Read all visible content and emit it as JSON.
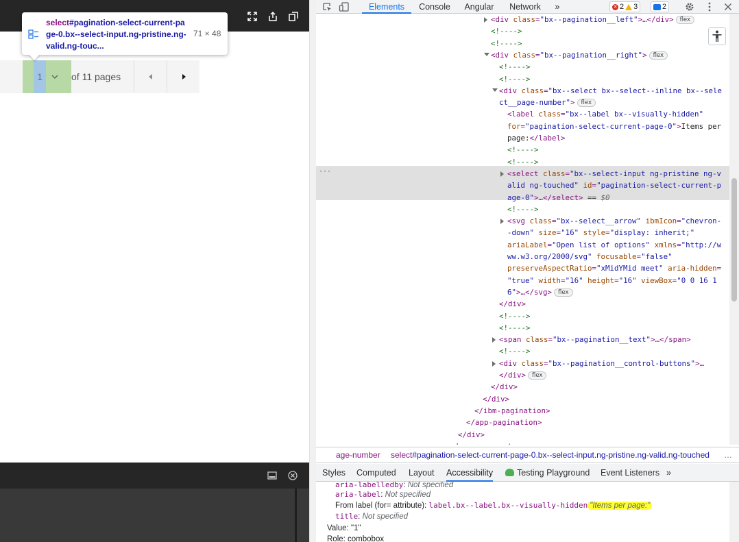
{
  "page": {
    "pager": {
      "current_page": "1",
      "of_pages_text": "of 11 pages"
    },
    "tooltip": {
      "tag": "select",
      "selector": "#pagination-select-current-page-0.bx--select-input.ng-pristine.ng-valid.ng-touc...",
      "size": "71 × 48"
    }
  },
  "devtools": {
    "tabs": [
      "Elements",
      "Console",
      "Angular",
      "Network"
    ],
    "tabs_more": "»",
    "errors_count": "2",
    "warnings_count": "3",
    "messages_count": "2",
    "dom_lines": [
      {
        "indent": 0,
        "arrow": "right",
        "html": "<span class=\"tg\">&lt;div </span><span class=\"attr\">class</span>=<span class=\"val\">\"bx--pagination__left\"</span>&gt;…&lt;/div&gt;",
        "badge": "flex"
      },
      {
        "indent": 0,
        "arrow": "",
        "html": "<span class=\"cmt\">&lt;!----&gt;</span>"
      },
      {
        "indent": 0,
        "arrow": "",
        "html": "<span class=\"cmt\">&lt;!----&gt;</span>"
      },
      {
        "indent": 0,
        "arrow": "down",
        "html": "&lt;div <span class=\"attr\">class</span>=<span class=\"val\">\"bx--pagination__right\"</span>&gt;",
        "badge": "flex"
      },
      {
        "indent": 1,
        "arrow": "",
        "html": "<span class=\"cmt\">&lt;!----&gt;</span>"
      },
      {
        "indent": 1,
        "arrow": "",
        "html": "<span class=\"cmt\">&lt;!----&gt;</span>"
      },
      {
        "indent": 1,
        "arrow": "down",
        "html": "&lt;div <span class=\"attr\">class</span>=<span class=\"val\">\"bx--select bx--select--inline bx--sele</span>"
      },
      {
        "indent": 1,
        "arrow": "",
        "html": "<span class=\"val\">ct__page-number\"</span>&gt;",
        "badge": "flex"
      },
      {
        "indent": 2,
        "arrow": "",
        "html": "&lt;label <span class=\"attr\">class</span>=<span class=\"val\">\"bx--label bx--visually-hidden\"</span>"
      },
      {
        "indent": 2,
        "arrow": "",
        "html": "<span class=\"attr\">for</span>=<span class=\"val\">\"pagination-select-current-page-0\"</span>&gt;<span class=\"txt\">Items per</span>"
      },
      {
        "indent": 2,
        "arrow": "",
        "html": "<span class=\"txt\">page:</span>&lt;/label&gt;"
      },
      {
        "indent": 2,
        "arrow": "",
        "html": "<span class=\"cmt\">&lt;!----&gt;</span>"
      },
      {
        "indent": 2,
        "arrow": "",
        "html": "<span class=\"cmt\">&lt;!----&gt;</span>"
      },
      {
        "indent": 2,
        "arrow": "right",
        "html": "&lt;select <span class=\"attr\">class</span>=<span class=\"val\">\"bx--select-input ng-pristine ng-v</span>"
      },
      {
        "indent": 2,
        "arrow": "",
        "html": "<span class=\"val\">alid ng-touched\"</span> <span class=\"attr\">id</span>=<span class=\"val\">\"pagination-select-current-p</span>"
      },
      {
        "indent": 2,
        "arrow": "",
        "html": "<span class=\"val\">age-0\"</span>&gt;…&lt;/select&gt; <span class=\"txt\">== </span><span style=\"color:#5f6368;font-style:italic\">$0</span>"
      },
      {
        "indent": 2,
        "arrow": "",
        "html": "<span class=\"cmt\">&lt;!----&gt;</span>"
      },
      {
        "indent": 2,
        "arrow": "right",
        "html": "&lt;svg <span class=\"attr\">class</span>=<span class=\"val\">\"bx--select__arrow\"</span> <span class=\"attr\">ibmIcon</span>=<span class=\"val\">\"chevron-</span>"
      },
      {
        "indent": 2,
        "arrow": "",
        "html": "<span class=\"val\">-down\"</span> <span class=\"attr\">size</span>=<span class=\"val\">\"16\"</span> <span class=\"attr\">style</span>=<span class=\"val\">\"display: inherit;\"</span>"
      },
      {
        "indent": 2,
        "arrow": "",
        "html": "<span class=\"attr\">ariaLabel</span>=<span class=\"val\">\"Open list of options\"</span> <span class=\"attr\">xmlns</span>=<span class=\"val\">\"http://w</span>"
      },
      {
        "indent": 2,
        "arrow": "",
        "html": "<span class=\"val\">ww.w3.org/2000/svg\"</span> <span class=\"attr\">focusable</span>=<span class=\"val\">\"false\"</span>"
      },
      {
        "indent": 2,
        "arrow": "",
        "html": "<span class=\"attr\">preserveAspectRatio</span>=<span class=\"val\">\"xMidYMid meet\"</span> <span class=\"attr\">aria-hidden</span>="
      },
      {
        "indent": 2,
        "arrow": "",
        "html": "<span class=\"val\">\"true\"</span> <span class=\"attr\">width</span>=<span class=\"val\">\"16\"</span> <span class=\"attr\">height</span>=<span class=\"val\">\"16\"</span> <span class=\"attr\">viewBox</span>=<span class=\"val\">\"0 0 16 1</span>"
      },
      {
        "indent": 2,
        "arrow": "",
        "html": "<span class=\"val\">6\"</span>&gt;…&lt;/svg&gt;",
        "badge": "flex"
      },
      {
        "indent": 1,
        "arrow": "",
        "html": "&lt;/div&gt;"
      },
      {
        "indent": 1,
        "arrow": "",
        "html": "<span class=\"cmt\">&lt;!----&gt;</span>"
      },
      {
        "indent": 1,
        "arrow": "",
        "html": "<span class=\"cmt\">&lt;!----&gt;</span>"
      },
      {
        "indent": 1,
        "arrow": "right",
        "html": "&lt;span <span class=\"attr\">class</span>=<span class=\"val\">\"bx--pagination__text\"</span>&gt;…&lt;/span&gt;"
      },
      {
        "indent": 1,
        "arrow": "",
        "html": "<span class=\"cmt\">&lt;!----&gt;</span>"
      },
      {
        "indent": 1,
        "arrow": "right",
        "html": "&lt;div <span class=\"attr\">class</span>=<span class=\"val\">\"bx--pagination__control-buttons\"</span>&gt;…"
      },
      {
        "indent": 1,
        "arrow": "",
        "html": "&lt;/div&gt;",
        "badge": "flex"
      },
      {
        "indent": 0,
        "arrow": "",
        "html": "&lt;/div&gt;"
      },
      {
        "indent": -1,
        "arrow": "",
        "html": "&lt;/div&gt;"
      },
      {
        "indent": -2,
        "arrow": "",
        "html": "&lt;/ibm-pagination&gt;"
      },
      {
        "indent": -3,
        "arrow": "",
        "html": "&lt;/app-pagination&gt;"
      },
      {
        "indent": -4,
        "arrow": "",
        "html": "&lt;/div&gt;"
      },
      {
        "indent": -5,
        "arrow": "",
        "html": "&lt;/ng-component&gt;"
      }
    ],
    "row_dots": "···",
    "breadcrumbs": {
      "item1": "age-number",
      "item2_tag": "select",
      "item2_rest": "#pagination-select-current-page-0.bx--select-input.ng-pristine.ng-valid.ng-touched",
      "more": "…"
    },
    "sub_tabs": [
      "Styles",
      "Computed",
      "Layout",
      "Accessibility",
      "Testing Playground",
      "Event Listeners"
    ],
    "sub_tabs_more": "»",
    "accessibility": {
      "labelledby_key": "aria-labelledby",
      "labelledby_val": "Not specified",
      "label_key": "aria-label",
      "label_val": "Not specified",
      "from_label_prefix": "From label (for= attribute):",
      "from_label_selector": "label.bx--label.bx--visually-hidden",
      "from_label_value": "\"Items per page:\"",
      "title_key": "title",
      "title_val": "Not specified",
      "value_line": "Value: \"1\"",
      "role_line": "Role: combobox"
    }
  }
}
